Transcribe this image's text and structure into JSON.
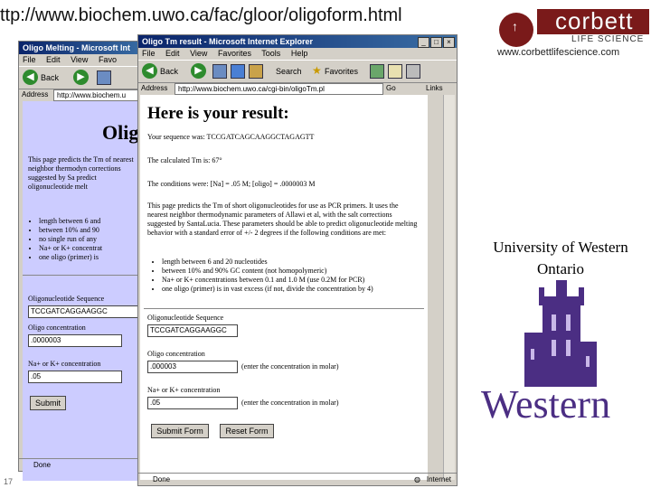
{
  "slide": {
    "url_title": "ttp://www.biochem.uwo.ca/fac/gloor/oligoform.html",
    "corbett_name": "corbett",
    "corbett_sub": "LIFE SCIENCE",
    "corbett_url": "www.corbettlifescience.com",
    "university": "University of Western Ontario",
    "western_word": "Western",
    "slide_number": "17"
  },
  "back_window": {
    "title": "Oligo Melting - Microsoft Int",
    "menu": [
      "File",
      "Edit",
      "View",
      "Favo"
    ],
    "back_label": "Back",
    "address_label": "Address",
    "address_value": "http://www.biochem.u",
    "heading": "Olig",
    "intro": "This page predicts the Tm of nearest neighbor thermodyn corrections suggested by Sa predict oligonucleotide melt",
    "bullets": [
      "length between 6 and",
      "between 10% and 90",
      "no single run of any",
      "Na+ or K+ concentrat",
      "one oligo (primer) is"
    ],
    "seq_label": "Oligonucleotide Sequence",
    "seq_value": "TCCGATCAGGAAGGC",
    "conc_label": "Oligo concentration",
    "conc_value": ".0000003",
    "na_label": "Na+ or K+ concentration",
    "na_value": ".05",
    "submit_label": "Submit",
    "status": "Done"
  },
  "front_window": {
    "title": "Oligo Tm result - Microsoft Internet Explorer",
    "menu": [
      "File",
      "Edit",
      "View",
      "Favorites",
      "Tools",
      "Help"
    ],
    "back_label": "Back",
    "search_label": "Search",
    "favorites_label": "Favorites",
    "address_label": "Address",
    "address_value": "http://www.biochem.uwo.ca/cgi-bin/oligoTm.pl",
    "go_label": "Go",
    "links_label": "Links",
    "result_heading": "Here is your result:",
    "sequence_line": "Your sequence was: TCCGATCAGCAAGGCTAGAGTT",
    "tm_line": "The calculated Tm is: 67°",
    "conditions_line": "The conditions were: [Na] = .05 M; [oligo] = .0000003 M",
    "description": "This page predicts the Tm of short oligonucleotides for use as PCR primers. It uses the nearest neighbor thermodynamic parameters of Allawi et al, with the salt corrections suggested by SantaLucia. These parameters should be able to predict oligonucleotide melting behavior with a standard error of +/- 2 degrees if the following conditions are met:",
    "bullets": [
      "length between 6 and 20 nucleotides",
      "between 10% and 90% GC content (not homopolymeric)",
      "Na+ or K+ concentrations between 0.1 and 1.0 M (use 0.2M for PCR)",
      "one oligo (primer) is in vast excess (if not, divide the concentration by 4)"
    ],
    "seq_label": "Oligonucleotide Sequence",
    "seq_value": "TCCGATCAGGAAGGC",
    "conc_label": "Oligo concentration",
    "conc_value": ".000003",
    "conc_hint": "(enter the concentration in molar)",
    "na_label": "Na+ or K+ concentration",
    "na_value": ".05",
    "na_hint": "(enter the concentration in molar)",
    "submit_label": "Submit Form",
    "reset_label": "Reset Form",
    "status": "Done",
    "zone": "Internet"
  }
}
